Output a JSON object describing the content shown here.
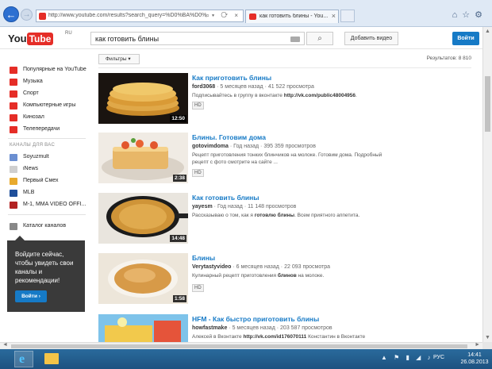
{
  "browser": {
    "url": "http://www.youtube.com/results?search_query=%D0%BA%D0%B0%D0",
    "tab_title": "как готовить блины - You...",
    "tab_close": "×",
    "back_glyph": "←",
    "fwd_glyph": "→"
  },
  "header": {
    "logo_you": "You",
    "logo_tube": "Tube",
    "logo_region": "RU",
    "search_query": "как готовить блины",
    "upload_label": "Добавить видео",
    "login_label": "Войти"
  },
  "sidebar": {
    "items": [
      {
        "label": "Популярные на YouTube",
        "color": "#e52d27"
      },
      {
        "label": "Музыка",
        "color": "#e52d27"
      },
      {
        "label": "Спорт",
        "color": "#e52d27"
      },
      {
        "label": "Компьютерные игры",
        "color": "#e52d27"
      },
      {
        "label": "Кинозал",
        "color": "#e52d27"
      },
      {
        "label": "Телепередачи",
        "color": "#e52d27"
      }
    ],
    "channels_heading": "КАНАЛЫ ДЛЯ ВАС",
    "channels": [
      {
        "label": "Soyuzmult",
        "color": "#6b8fd1"
      },
      {
        "label": "iNews",
        "color": "#cfcfcf"
      },
      {
        "label": "Первый Смех",
        "color": "#e8aa2e"
      },
      {
        "label": "MLB",
        "color": "#1f4f9a"
      },
      {
        "label": "M-1, MMA VIDEO OFFI...",
        "color": "#b22222"
      }
    ],
    "catalog_label": "Каталог каналов",
    "promo_text": "Войдите сейчас, чтобы увидеть свои каналы и рекомендации!",
    "promo_button": "Войти ›"
  },
  "main": {
    "filters_label": "Фильтры ▾",
    "results_count": "Результатов: 8 810",
    "videos": [
      {
        "title": "Как приготовить блины",
        "channel": "ford3068",
        "age": "5 месяцев назад",
        "views": "41 522 просмотра",
        "desc_line1": "Подписывайтесь в группу в вконтакте ",
        "desc_link": "http://vk.com/public48004956",
        "desc_line2": ".",
        "duration": "12:50",
        "badge": "HD"
      },
      {
        "title": "Блины. Готовим дома",
        "channel": "gotovimdoma",
        "age": "Год назад",
        "views": "395 359 просмотров",
        "desc_line1": "Рецепт приготовления тонких блинчиков на молоке. Готовим дома. Подробный рецепт с фото смотрите на сайте ...",
        "desc_link": "",
        "desc_line2": "",
        "duration": "2:38",
        "badge": "HD"
      },
      {
        "title": "Как готовить блины",
        "channel": "yayesm",
        "age": "Год назад",
        "views": "11 148 просмотров",
        "desc_line1": "Рассказываю о том, как я ",
        "desc_link": "готовлю блины",
        "desc_line2": ". Всем приятного аппетита.",
        "duration": "14:48",
        "badge": ""
      },
      {
        "title": "Блины",
        "channel": "Verytastyvideo",
        "age": "6 месяцев назад",
        "views": "22 093 просмотра",
        "desc_line1": "Кулинарный рецепт приготовления ",
        "desc_link": "блинов",
        "desc_line2": " на молоке.",
        "duration": "1:58",
        "badge": "HD"
      },
      {
        "title": "HFM - Как быстро приготовить блины",
        "channel": "howfastmake",
        "age": "5 месяцев назад",
        "views": "203 587 просмотров",
        "desc_line1": "Алексей в Вконтакте ",
        "desc_link": "http://vk.com/id176070111",
        "desc_line2": " Константин в Вконтакте",
        "duration": "",
        "badge": ""
      }
    ]
  },
  "taskbar": {
    "lang": "РУС",
    "time": "14:41",
    "date": "26.08.2013"
  }
}
